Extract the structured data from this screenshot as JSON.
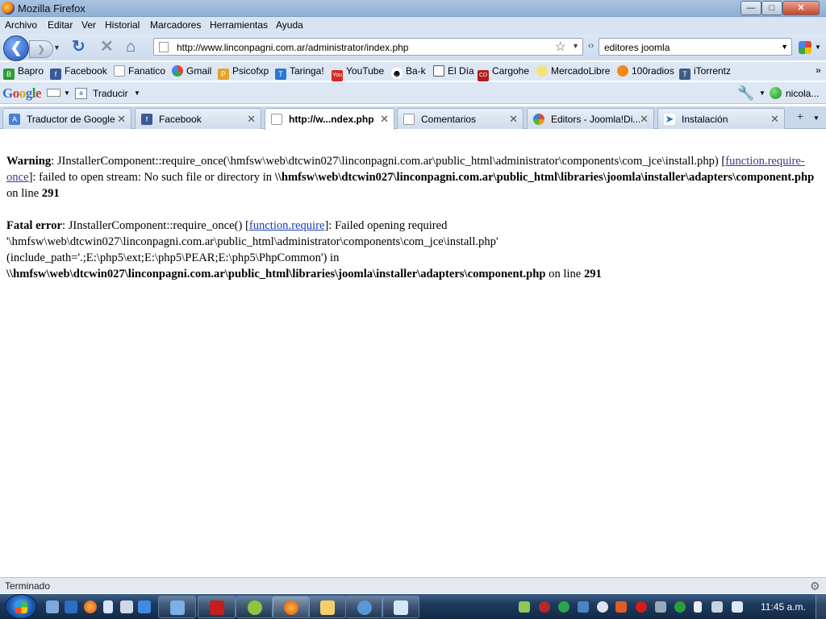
{
  "window": {
    "title": "Mozilla Firefox"
  },
  "menu": [
    "Archivo",
    "Editar",
    "Ver",
    "Historial",
    "Marcadores",
    "Herramientas",
    "Ayuda"
  ],
  "nav": {
    "url": "http://www.linconpagni.com.ar/administrator/index.php",
    "search_value": "editores joomla"
  },
  "bookmarks": [
    "Bapro",
    "Facebook",
    "Fanatico",
    "Gmail",
    "Psicofxp",
    "Taringa!",
    "YouTube",
    "Ba-k",
    "El Día",
    "Cargohe",
    "MercadoLibre",
    "100radios",
    "iTorrentz"
  ],
  "google_toolbar": {
    "logo": "Google",
    "translate_label": "Traducir",
    "user_label": "nicola..."
  },
  "tabs": [
    {
      "label": "Traductor de Google",
      "active": false
    },
    {
      "label": "Facebook",
      "active": false
    },
    {
      "label": "http://w...ndex.php",
      "active": true
    },
    {
      "label": "Comentarios",
      "active": false
    },
    {
      "label": "Editors - Joomla!Di...",
      "active": false
    },
    {
      "label": "Instalación",
      "active": false
    }
  ],
  "content": {
    "warning": {
      "label": "Warning",
      "text1": ": JInstallerComponent::require_once(\\hmfsw\\web\\dtcwin027\\linconpagni.com.ar\\public_html\\administrator\\components\\com_jce\\install.php) [",
      "link": "function.require-once",
      "text2": "]: failed to open stream: No such file or directory in ",
      "path": "\\\\hmfsw\\web\\dtcwin027\\linconpagni.com.ar\\public_html\\libraries\\joomla\\installer\\adapters\\component.php",
      "online": " on line ",
      "line": "291"
    },
    "fatal": {
      "label": "Fatal error",
      "text1": ": JInstallerComponent::require_once() [",
      "link": "function.require",
      "text2": "]: Failed opening required '\\hmfsw\\web\\dtcwin027\\linconpagni.com.ar\\public_html\\administrator\\components\\com_jce\\install.php' (include_path='.;E:\\php5\\ext;E:\\php5\\PEAR;E:\\php5\\PhpCommon') in ",
      "path": "\\\\hmfsw\\web\\dtcwin027\\linconpagni.com.ar\\public_html\\libraries\\joomla\\installer\\adapters\\component.php",
      "online": " on line ",
      "line": "291"
    }
  },
  "status": {
    "text": "Terminado"
  },
  "taskbar": {
    "clock": "11:45 a.m."
  }
}
